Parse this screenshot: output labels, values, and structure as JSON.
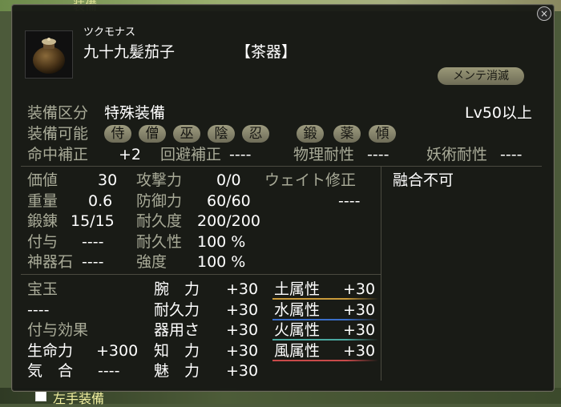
{
  "background": {
    "top_label": "一　　装備",
    "bottom_label": "左手装備"
  },
  "close_label": "×",
  "item": {
    "reading": "ツクモナス",
    "name": "九十九髪茄子",
    "category": "【茶器】",
    "badge": "メンテ消滅"
  },
  "equip": {
    "class_label": "装備区分",
    "class_value": "特殊装備",
    "level_req": "Lv50以上",
    "possible_label": "装備可能",
    "classes": [
      "侍",
      "僧",
      "巫",
      "陰",
      "忍",
      "鍛",
      "薬",
      "傾"
    ]
  },
  "resists": {
    "hit_label": "命中補正",
    "hit_value": "+2",
    "evade_label": "回避補正",
    "evade_value": "----",
    "phys_label": "物理耐性",
    "phys_value": "----",
    "magic_label": "妖術耐性",
    "magic_value": "----"
  },
  "stats": {
    "value_label": "価値",
    "value_value": "30",
    "weight_label": "重量",
    "weight_value": "0.6",
    "forge_label": "鍛錬",
    "forge_value": "15/15",
    "grant_label": "付与",
    "grant_value": "----",
    "stone_label": "神器石",
    "stone_value": "----",
    "attack_label": "攻撃力",
    "attack_value": "0/0",
    "defense_label": "防御力",
    "defense_value": "60/60",
    "dur_label": "耐久度",
    "dur_value": "200/200",
    "durp_label": "耐久性",
    "durp_value": "100 %",
    "str_label": "強度",
    "str_value": "100 %",
    "weight_fix_label": "ウェイト修正",
    "weight_fix_value": "----",
    "fusion": "融合不可"
  },
  "extras": {
    "gem_label": "宝玉",
    "gem_value": "----",
    "effect_label": "付与効果",
    "life_label": "生命力",
    "life_value": "+300",
    "ki_label": "気　合",
    "ki_value": "----"
  },
  "attributes": [
    {
      "label": "腕　力",
      "value": "+30"
    },
    {
      "label": "耐久力",
      "value": "+30"
    },
    {
      "label": "器用さ",
      "value": "+30"
    },
    {
      "label": "知　力",
      "value": "+30"
    },
    {
      "label": "魅　力",
      "value": "+30"
    }
  ],
  "elements": [
    {
      "label": "土属性",
      "value": "+30",
      "color": "#c89a3a"
    },
    {
      "label": "水属性",
      "value": "+30",
      "color": "#3a6ec8"
    },
    {
      "label": "火属性",
      "value": "+30",
      "color": "#4aa8a0"
    },
    {
      "label": "風属性",
      "value": "+30",
      "color": "#c84a4a"
    }
  ]
}
